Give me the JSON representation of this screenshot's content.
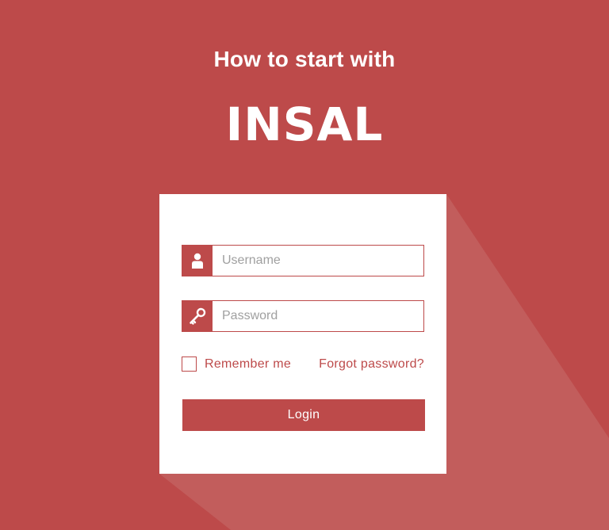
{
  "header": {
    "subtitle": "How to start with",
    "brand": "INSAL"
  },
  "login_form": {
    "username": {
      "placeholder": "Username",
      "value": "",
      "icon": "user-icon"
    },
    "password": {
      "placeholder": "Password",
      "value": "",
      "icon": "key-icon"
    },
    "remember_label": "Remember me",
    "remember_checked": false,
    "forgot_label": "Forgot password?",
    "submit_label": "Login"
  },
  "colors": {
    "background": "#bd4a4a",
    "accent": "#bd4a4a",
    "card": "#ffffff",
    "long_shadow": "#c25d5c"
  }
}
